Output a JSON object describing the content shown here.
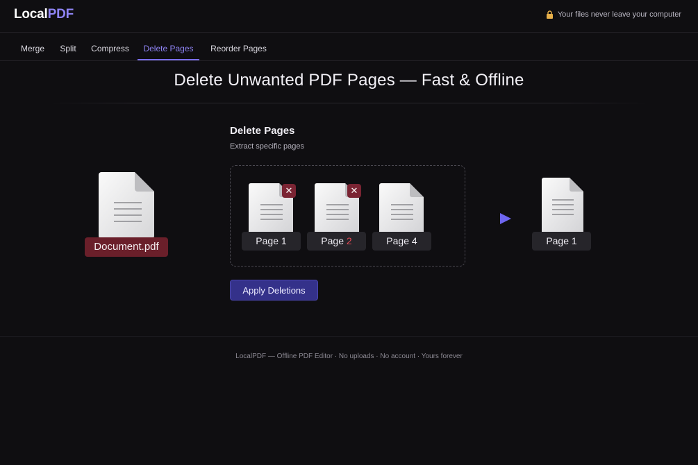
{
  "header": {
    "brand_local": "Local",
    "brand_pdf": "PDF",
    "privacy_text": "Your files never leave your computer",
    "privacy_icon": "lock-icon"
  },
  "tabs": [
    {
      "label": "Merge",
      "active": false
    },
    {
      "label": "Split",
      "active": false
    },
    {
      "label": "Compress",
      "active": false
    },
    {
      "label": "Delete Pages",
      "active": true
    },
    {
      "label": "Reorder Pages",
      "active": false
    }
  ],
  "main": {
    "headline": "Delete Unwanted PDF Pages — Fast & Offline",
    "section_title": "Delete Pages",
    "section_subtitle": "Extract specific pages"
  },
  "illustration": {
    "source_file": "Document.pdf",
    "pages": [
      {
        "prefix": "Page ",
        "number": "1",
        "marked_delete": true,
        "number_highlight": false
      },
      {
        "prefix": "Page ",
        "number": "2",
        "marked_delete": true,
        "number_highlight": true
      },
      {
        "prefix": "Page ",
        "number": "4",
        "marked_delete": false,
        "number_highlight": false
      }
    ],
    "delete_glyph": "✕",
    "result_page": "Page 1"
  },
  "actions": {
    "apply_label": "Apply Deletions"
  },
  "footer": {
    "text": "LocalPDF — Offline PDF Editor · No uploads · No account · Yours forever"
  },
  "colors": {
    "accent": "#8f84f5",
    "background": "#0f0e11",
    "danger": "#7a2433",
    "button": "#34318a"
  }
}
